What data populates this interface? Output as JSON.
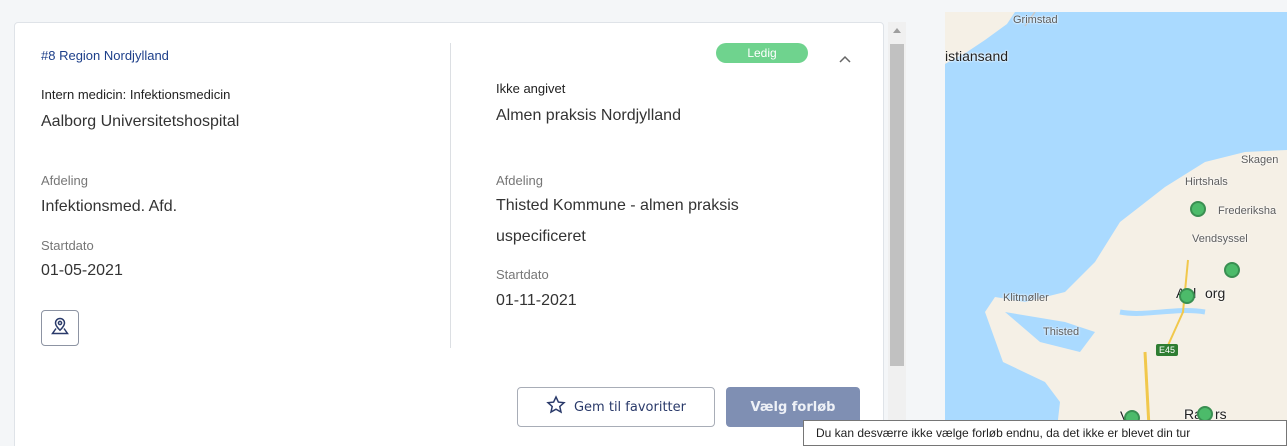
{
  "card": {
    "left": {
      "region": "#8 Region Nordjylland",
      "specialty": "Intern medicin: Infektionsmedicin",
      "hospital": "Aalborg Universitetshospital",
      "department_label": "Afdeling",
      "department_value": "Infektionsmed. Afd.",
      "start_label": "Startdato",
      "start_value": "01-05-2021",
      "map_button_icon": "map-pin-icon"
    },
    "right": {
      "badge": "Ledig",
      "specialty": "Ikke angivet",
      "hospital": "Almen praksis Nordjylland",
      "department_label": "Afdeling",
      "department_value_line1": "Thisted Kommune - almen praksis",
      "department_value_line2": "uspecificeret",
      "start_label": "Startdato",
      "start_value": "01-11-2021"
    },
    "actions": {
      "favorite_label": "Gem til favoritter",
      "choose_label": "Vælg forløb"
    }
  },
  "map": {
    "labels": {
      "grimstad": "Grimstad",
      "kristiansand": "istiansand",
      "skagen": "Skagen",
      "hirtshals": "Hirtshals",
      "frederikshavn": "Frederiksha",
      "vendsyssel": "Vendsyssel",
      "aalborg_a": "Aal",
      "aalborg_b": "org",
      "klitmoller": "Klitmøller",
      "thisted": "Thisted",
      "e45": "E45",
      "randers_a": "Ra",
      "randers_b": "rs",
      "viborg": "Vi"
    }
  },
  "tooltip": "Du kan desværre ikke vælge forløb endnu, da det ikke er blevet din tur",
  "colors": {
    "badge": "#6fd38e",
    "choose_button": "#7f8fb3",
    "marker": "#4cbb6a",
    "water": "#aadaff",
    "land": "#f5f0e6"
  }
}
